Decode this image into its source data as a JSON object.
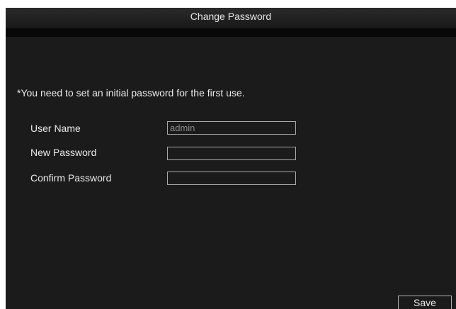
{
  "dialog": {
    "title": "Change Password"
  },
  "notice": "*You need to set an initial password for the first use.",
  "form": {
    "user_name": {
      "label": "User Name",
      "value": "admin"
    },
    "new_password": {
      "label": "New Password",
      "value": ""
    },
    "confirm_password": {
      "label": "Confirm Password",
      "value": ""
    }
  },
  "buttons": {
    "save_label": "Save"
  },
  "colors": {
    "background": "#1b1b1b",
    "title_band": "#080808",
    "text": "#eaeaea",
    "input_border": "#a8a8a8",
    "readonly_text": "#8c8c8c"
  }
}
